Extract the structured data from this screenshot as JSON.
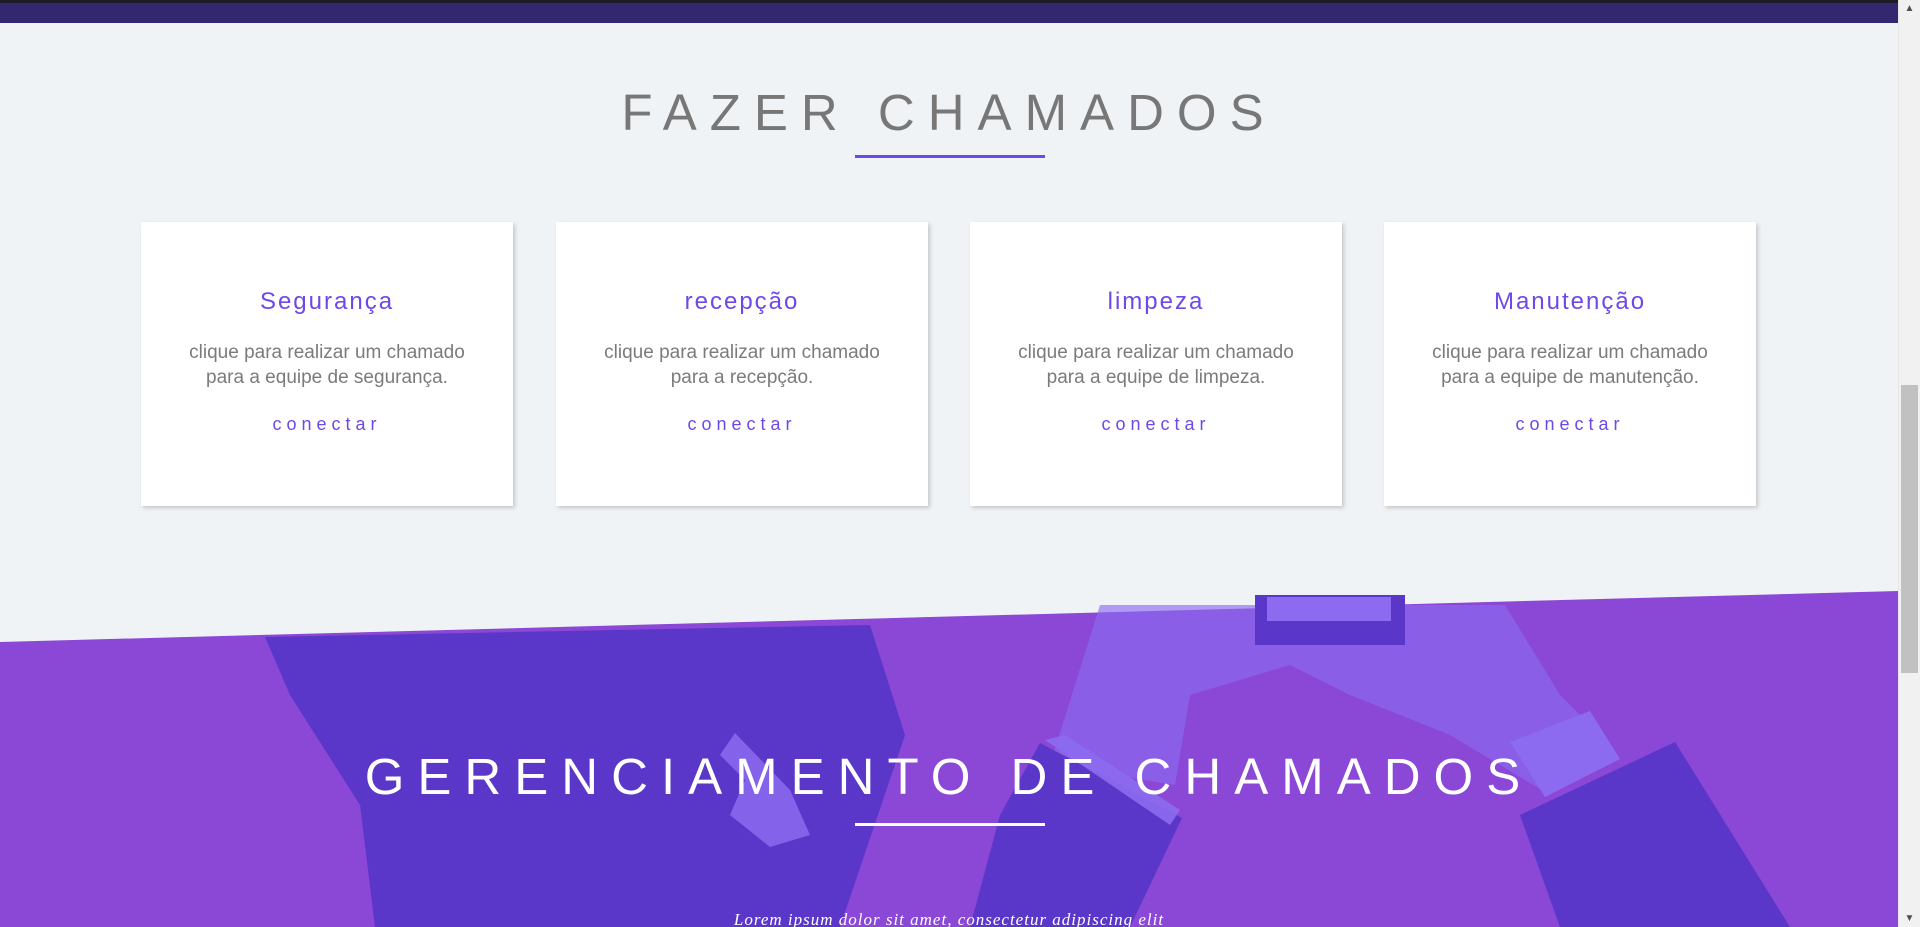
{
  "calls_section": {
    "title": "FAZER CHAMADOS",
    "cards": [
      {
        "title": "Segurança",
        "description": "clique para realizar um chamado para a equipe de segurança.",
        "link": "conectar"
      },
      {
        "title": "recepção",
        "description": "clique para realizar um chamado para a recepção.",
        "link": "conectar"
      },
      {
        "title": "limpeza",
        "description": "clique para realizar um chamado para a equipe de limpeza.",
        "link": "conectar"
      },
      {
        "title": "Manutenção",
        "description": "clique para realizar um chamado para a equipe de manutenção.",
        "link": "conectar"
      }
    ]
  },
  "manage_section": {
    "title": "GERENCIAMENTO DE CHAMADOS",
    "text": "Lorem ipsum dolor sit amet, consectetur adipiscing elit"
  },
  "colors": {
    "accent": "#6e48e8",
    "topbar": "#33276f",
    "manage_bg": "#8b47d6",
    "manage_dark": "#5a37c8",
    "manage_light": "#8c6bf0"
  },
  "scrollbar": {
    "up_icon": "chevron-up-icon",
    "down_icon": "chevron-down-icon"
  }
}
